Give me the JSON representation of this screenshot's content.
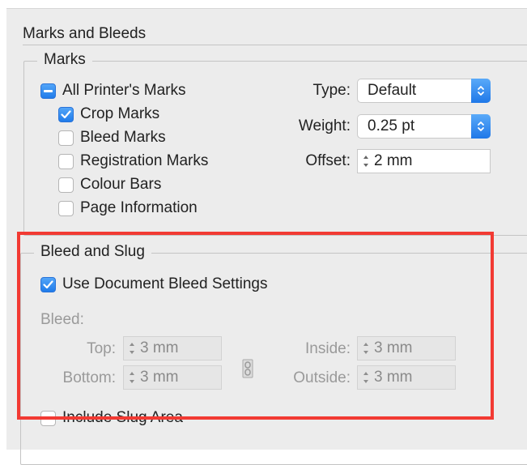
{
  "panel": {
    "title": "Marks and Bleeds"
  },
  "marks": {
    "legend": "Marks",
    "all_printers_marks": {
      "label": "All Printer's Marks",
      "state": "mixed"
    },
    "items": [
      {
        "label": "Crop Marks",
        "checked": true
      },
      {
        "label": "Bleed Marks",
        "checked": false
      },
      {
        "label": "Registration Marks",
        "checked": false
      },
      {
        "label": "Colour Bars",
        "checked": false
      },
      {
        "label": "Page Information",
        "checked": false
      }
    ],
    "type": {
      "label": "Type:",
      "value": "Default"
    },
    "weight": {
      "label": "Weight:",
      "value": "0.25 pt"
    },
    "offset": {
      "label": "Offset:",
      "value": "2 mm"
    }
  },
  "bleed_slug": {
    "legend": "Bleed and Slug",
    "use_document": {
      "label": "Use Document Bleed Settings",
      "checked": true
    },
    "bleed_label": "Bleed:",
    "top": {
      "label": "Top:",
      "value": "3 mm"
    },
    "bottom": {
      "label": "Bottom:",
      "value": "3 mm"
    },
    "inside": {
      "label": "Inside:",
      "value": "3 mm"
    },
    "outside": {
      "label": "Outside:",
      "value": "3 mm"
    },
    "include_slug": {
      "label": "Include Slug Area",
      "checked": false
    }
  },
  "colors": {
    "accent": "#1f7bea",
    "highlight": "#f23a33"
  }
}
